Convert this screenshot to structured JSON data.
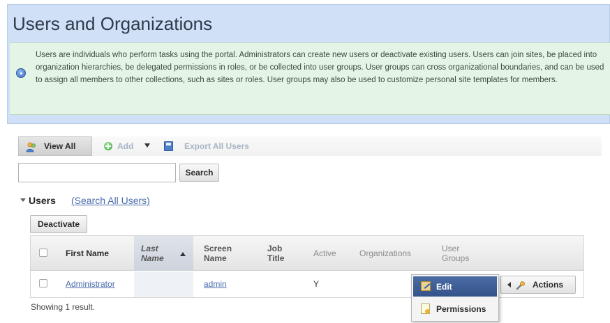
{
  "page": {
    "title": "Users and Organizations",
    "info_text": "Users are individuals who perform tasks using the portal. Administrators can create new users or deactivate existing users. Users can join sites, be placed into organization hierarchies, be delegated permissions in roles, or be collected into user groups. User groups can cross organizational boundaries, and can be used to assign all members to other collections, such as sites or roles. User groups may also be used to customize personal site templates for members."
  },
  "toolbar": {
    "view_all": "View All",
    "add": "Add",
    "export": "Export All Users",
    "icons": {
      "view_all": "people-icon",
      "add": "add-icon",
      "export": "export-icon"
    }
  },
  "search": {
    "value": "",
    "button": "Search"
  },
  "section": {
    "title": "Users",
    "link": "(Search All Users)"
  },
  "table": {
    "deactivate": "Deactivate",
    "columns": {
      "first_name": "First Name",
      "last_name": "Last Name",
      "screen_name": "Screen Name",
      "job_title": "Job Title",
      "active": "Active",
      "organizations": "Organizations",
      "user_groups": "User Groups"
    },
    "sorted_column": "Last Name",
    "sort_direction": "ascending",
    "rows": [
      {
        "first_name": "Administrator",
        "last_name": "",
        "screen_name": "admin",
        "job_title": "",
        "active": "Y",
        "organizations": "",
        "user_groups": ""
      }
    ],
    "actions_label": "Actions"
  },
  "actions_menu": {
    "items": [
      {
        "label": "Edit",
        "icon": "edit-icon",
        "highlighted": true
      },
      {
        "label": "Permissions",
        "icon": "permissions-icon",
        "highlighted": false
      }
    ]
  },
  "footer": {
    "showing": "Showing 1 result."
  },
  "colors": {
    "header_bg": "#cfe0f7",
    "info_bg": "#e4f5e6",
    "link": "#4a6cae",
    "menu_highlight": "#3f5f98"
  }
}
